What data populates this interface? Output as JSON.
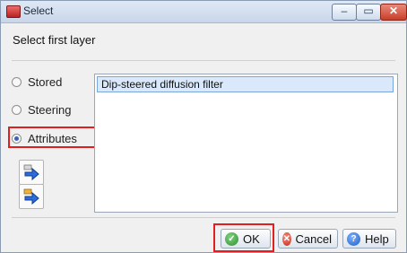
{
  "window": {
    "title": "Select",
    "controls": {
      "minimize": "–",
      "maximize": "▭",
      "close": "✕"
    }
  },
  "dialog": {
    "subtitle": "Select first layer"
  },
  "radios": [
    {
      "label": "Stored",
      "checked": false
    },
    {
      "label": "Steering",
      "checked": false
    },
    {
      "label": "Attributes",
      "checked": true
    }
  ],
  "list": {
    "items": [
      "Dip-steered diffusion filter"
    ],
    "selected": "Dip-steered diffusion filter"
  },
  "buttons": {
    "ok": "OK",
    "cancel": "Cancel",
    "help": "Help"
  },
  "icons": {
    "tool1": "import-arrow-icon",
    "tool2": "export-arrow-icon",
    "ok": "check-circle-icon",
    "cancel": "x-circle-icon",
    "help": "question-circle-icon"
  },
  "colors": {
    "highlight": "#e02020",
    "selection": "#d9e8fb",
    "radio_active": "#3a63b0"
  }
}
